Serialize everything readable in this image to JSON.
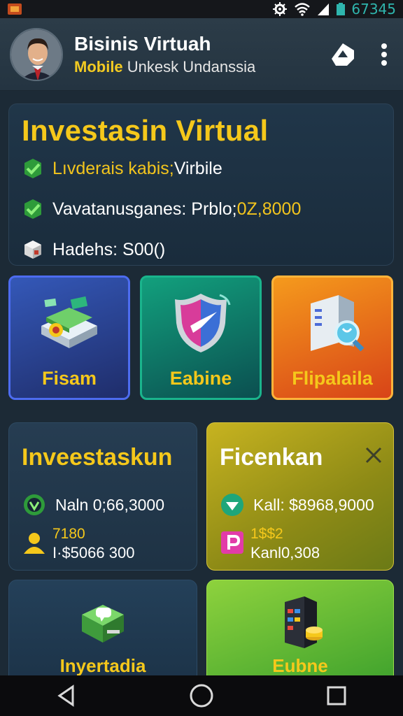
{
  "status_bar": {
    "battery_text": "67345",
    "icons": [
      "app-icon",
      "gear-icon",
      "wifi-icon",
      "signal-icon",
      "battery-icon"
    ]
  },
  "header": {
    "title": "Bisinis Virtuah",
    "subtitle_accent": "Mobile",
    "subtitle_rest": " Unkesk Undanssia"
  },
  "hero": {
    "title": "Investasin Virtual",
    "rows": [
      {
        "icon": "check-icon",
        "label": "Lıvderais kabis;",
        "value": " Virbile"
      },
      {
        "icon": "check-icon",
        "label": "Vavatanusganes: Prblo;",
        "value": " 0Z,8000"
      },
      {
        "icon": "cube-icon",
        "label": "Hadehs: S00()",
        "value": ""
      }
    ]
  },
  "tiles": [
    {
      "label": "Fisam",
      "icon": "money-stack-icon"
    },
    {
      "label": "Eabine",
      "icon": "shield-icon"
    },
    {
      "label": "Flipalaila",
      "icon": "server-search-icon"
    }
  ],
  "card_left": {
    "title": "Inveestaskun",
    "metric1": "Naln 0;66,3000",
    "metric2_a": "7180",
    "metric2_b": "I·$5066 300"
  },
  "card_right": {
    "title": "Ficenkan",
    "metric1": "Kall: $8968,9000",
    "metric2_a": "1$$2",
    "metric2_b": "Kanl0,308"
  },
  "bottom_cards": [
    {
      "label": "Inyertadia",
      "icon": "chat-box-icon"
    },
    {
      "label": "Eubne",
      "icon": "server-coins-icon"
    }
  ],
  "colors": {
    "accent_yellow": "#f5c81b",
    "background": "#1c2a36",
    "tile_blue": "#3458b8",
    "tile_green": "#12a07d",
    "tile_orange": "#f59a1c"
  }
}
